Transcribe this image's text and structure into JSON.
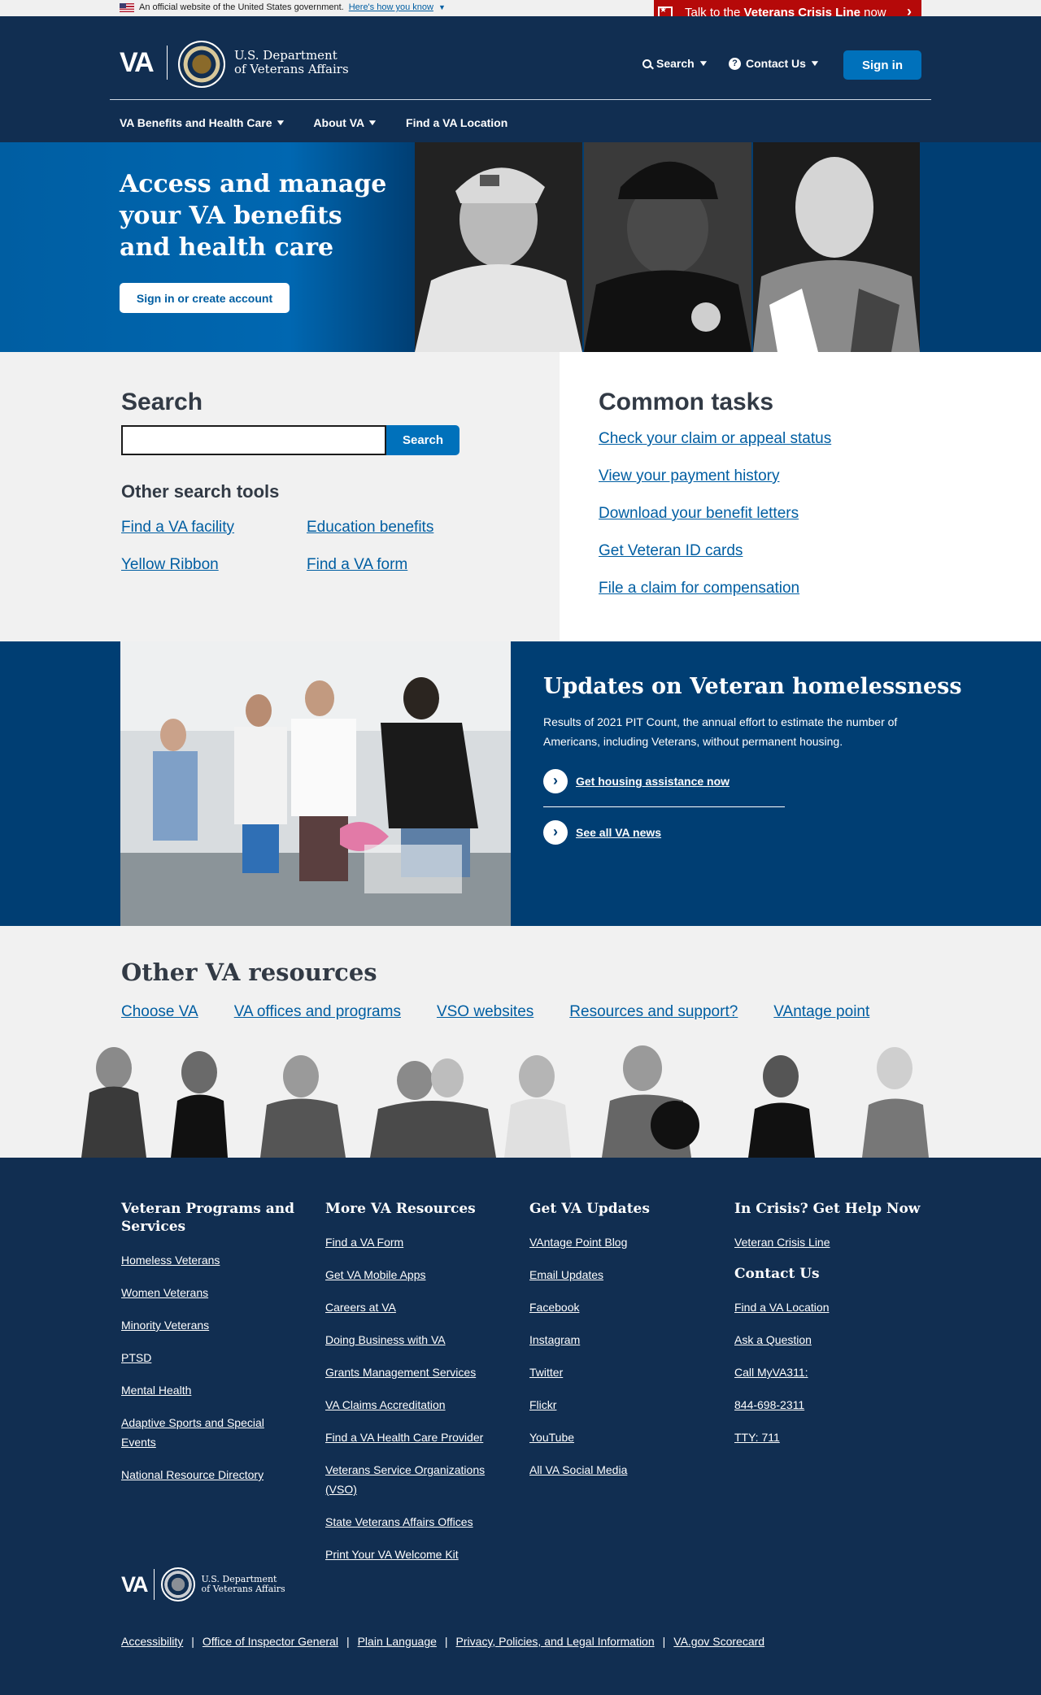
{
  "gov_banner": {
    "text": "An official website of the United States government.",
    "how_link": "Here's how you know"
  },
  "crisis_banner": {
    "prefix": "Talk to the ",
    "bold": "Veterans Crisis Line",
    "suffix": " now"
  },
  "header": {
    "logo": "VA",
    "dept_line1": "U.S. Department",
    "dept_line2": "of Veterans Affairs",
    "search_label": "Search",
    "contact_label": "Contact Us",
    "signin_label": "Sign in",
    "nav": [
      "VA Benefits and Health Care",
      "About VA",
      "Find a VA Location"
    ]
  },
  "hero": {
    "title": "Access and manage your VA benefits and health care",
    "button": "Sign in or create account"
  },
  "search": {
    "heading": "Search",
    "input_value": "",
    "button": "Search",
    "other_heading": "Other search tools",
    "tools": [
      "Find a VA facility",
      "Education benefits",
      "Yellow Ribbon",
      "Find a VA form"
    ]
  },
  "common_tasks": {
    "heading": "Common tasks",
    "links": [
      "Check your claim or appeal status",
      "View your payment history",
      "Download your benefit letters",
      "Get Veteran ID cards",
      "File a claim for compensation"
    ]
  },
  "feature": {
    "heading": "Updates on Veteran homelessness",
    "body": "Results of 2021 PIT Count, the annual effort to estimate the number of Americans, including Veterans, without permanent housing.",
    "link1": "Get housing assistance now",
    "link2": "See all VA news"
  },
  "resources": {
    "heading": "Other VA resources",
    "links": [
      "Choose VA",
      "VA offices and programs",
      "VSO websites",
      "Resources and support?",
      "VAntage point"
    ]
  },
  "footer": {
    "col1": {
      "heading": "Veteran Programs and Services",
      "links": [
        "Homeless Veterans",
        "Women Veterans",
        "Minority Veterans",
        "PTSD",
        "Mental Health",
        "Adaptive Sports and Special Events",
        "National Resource Directory"
      ]
    },
    "col2": {
      "heading": "More VA Resources",
      "links": [
        "Find a VA Form",
        "Get VA Mobile Apps",
        "Careers at VA",
        "Doing Business with VA",
        "Grants Management Services",
        "VA Claims Accreditation",
        "Find a VA Health Care Provider",
        "Veterans Service Organizations (VSO)",
        "State Veterans Affairs Offices",
        "Print Your VA Welcome Kit"
      ]
    },
    "col3": {
      "heading": "Get VA Updates",
      "links": [
        "VAntage Point Blog",
        "Email Updates",
        "Facebook",
        "Instagram",
        "Twitter",
        "Flickr",
        "YouTube",
        "All VA Social Media"
      ]
    },
    "col4": {
      "heading": "In Crisis? Get Help Now",
      "links": [
        "Veteran Crisis Line"
      ],
      "contact_heading": "Contact Us",
      "contact_links": [
        "Find a VA Location",
        "Ask a Question",
        "Call MyVA311:",
        "844-698-2311",
        "TTY: 711"
      ]
    },
    "logo": "VA",
    "dept_line1": "U.S. Department",
    "dept_line2": "of Veterans Affairs",
    "bottom_links": [
      "Accessibility",
      "Office of Inspector General",
      "Plain Language",
      "Privacy, Policies, and Legal Information",
      "VA.gov Scorecard"
    ],
    "separator": "|"
  }
}
